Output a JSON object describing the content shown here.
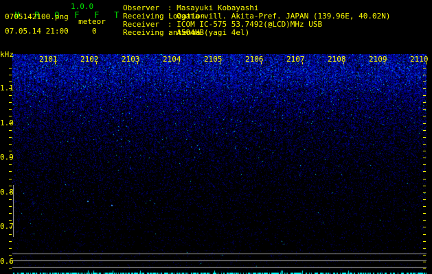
{
  "app": {
    "title_letters": [
      "H",
      "R",
      "O",
      "F",
      "F",
      "T"
    ],
    "version": "1.0.0"
  },
  "file": {
    "name": "0705142100.png",
    "datetime": "07.05.14 21:00"
  },
  "meteor": {
    "label": "meteor",
    "count": "0"
  },
  "info": [
    {
      "label": "Observer",
      "value": ": Masayuki Kobayashi"
    },
    {
      "label": "Receiving Location",
      "value": ": Ogata-vill. Akita-Pref. JAPAN (139.96E, 40.02N)"
    },
    {
      "label": "Receiver",
      "value": ": ICOM IC-575 53.7492(@LCD)MHz USB"
    },
    {
      "label": "Receiving antenna",
      "value": ": A504HB(yagi 4el)"
    }
  ],
  "spectrogram": {
    "y_unit": "kHz",
    "y_labels": [
      "1.1",
      "1.0",
      "0.9",
      "0.8",
      "0.7",
      "0.6"
    ],
    "x_labels": [
      "2101",
      "2102",
      "2103",
      "2104",
      "2105",
      "2106",
      "2107",
      "2108",
      "2109",
      "2110"
    ],
    "colors": {
      "text": "#ffff00",
      "title": "#00e000",
      "signal": "#0000ff",
      "echo": "#00ffff",
      "guide_line": "#909090"
    }
  }
}
